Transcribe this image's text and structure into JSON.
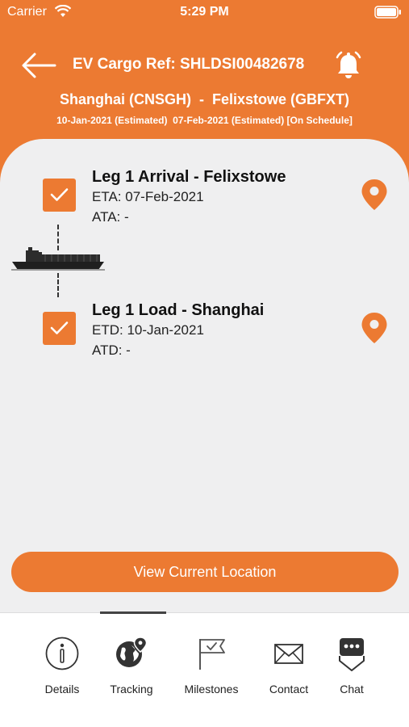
{
  "status_bar": {
    "carrier": "Carrier",
    "time": "5:29 PM"
  },
  "header": {
    "ref_title": "EV Cargo Ref: SHLDSI00482678",
    "route": "Shanghai (CNSGH)  -  Felixstowe (GBFXT)",
    "dates": "10-Jan-2021 (Estimated)  07-Feb-2021 (Estimated) [On Schedule]"
  },
  "legs": [
    {
      "title": "Leg 1 Arrival - Felixstowe",
      "line1": "ETA: 07-Feb-2021",
      "line2": "ATA: -",
      "checked": true
    },
    {
      "title": "Leg 1 Load - Shanghai",
      "line1": "ETD: 10-Jan-2021",
      "line2": "ATD: -",
      "checked": true
    }
  ],
  "view_location_label": "View Current Location",
  "tabs": [
    {
      "label": "Details",
      "icon": "info-icon"
    },
    {
      "label": "Tracking",
      "icon": "globe-pin-icon",
      "active": true
    },
    {
      "label": "Milestones",
      "icon": "flag-icon"
    },
    {
      "label": "Contact",
      "icon": "envelope-icon"
    },
    {
      "label": "Chat",
      "icon": "chat-icon"
    }
  ],
  "colors": {
    "accent": "#ec7a32",
    "background": "#efeff0",
    "tabbar": "#ffffff"
  }
}
